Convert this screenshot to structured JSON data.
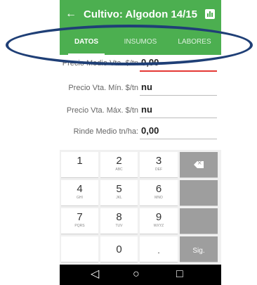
{
  "toolbar": {
    "back_icon": "arrow-left-icon",
    "title": "Cultivo: Algodon 14/15",
    "chart_icon": "bar-chart-icon"
  },
  "tabs": [
    {
      "label": "DATOS",
      "selected": true
    },
    {
      "label": "INSUMOS",
      "selected": false
    },
    {
      "label": "LABORES",
      "selected": false
    }
  ],
  "form": {
    "fields": [
      {
        "label": "Precio Medio Vta. $/tn",
        "value": "0,00"
      },
      {
        "label": "Precio Vta. Mín. $/tn",
        "value": "nu"
      },
      {
        "label": "Precio Vta. Máx. $/tn",
        "value": "nu"
      },
      {
        "label": "Rinde Medio tn/ha:",
        "value": "0,00"
      }
    ]
  },
  "keyboard": {
    "keys": [
      {
        "main": "1",
        "sub": ""
      },
      {
        "main": "2",
        "sub": "ABC"
      },
      {
        "main": "3",
        "sub": "DEF"
      },
      {
        "main": "4",
        "sub": "GHI"
      },
      {
        "main": "5",
        "sub": "JKL"
      },
      {
        "main": "6",
        "sub": "MNO"
      },
      {
        "main": "7",
        "sub": "PQRS"
      },
      {
        "main": "8",
        "sub": "TUV"
      },
      {
        "main": "9",
        "sub": "WXYZ"
      },
      {
        "main": "0",
        "sub": ""
      },
      {
        "main": ".",
        "sub": ""
      }
    ],
    "next_label": "Sig.",
    "backspace_icon": "backspace-icon"
  },
  "navbar": {
    "back": "◁",
    "home": "○",
    "recents": "□"
  },
  "colors": {
    "accent": "#4caf50",
    "focus_line": "#e53935",
    "key_fn": "#9e9e9e",
    "annotation": "#1f3f76"
  }
}
